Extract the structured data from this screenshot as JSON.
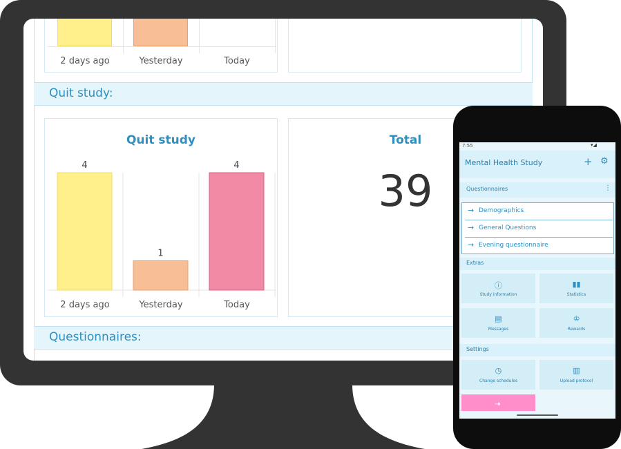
{
  "dashboard": {
    "section_quit_study": "Quit study:",
    "section_questionnaires": "Questionnaires:",
    "top_chart": {
      "categories": [
        "2 days ago",
        "Yesterday",
        "Today"
      ]
    },
    "total_panel": {
      "title": "Total",
      "value": "39"
    }
  },
  "chart_data": [
    {
      "type": "bar",
      "title": "Quit study",
      "categories": [
        "2 days ago",
        "Yesterday",
        "Today"
      ],
      "values": [
        4,
        1,
        4
      ],
      "colors": [
        "#fff08c",
        "#f8bf96",
        "#f28aa6"
      ],
      "ylim": [
        0,
        4
      ],
      "grid": true
    }
  ],
  "phone": {
    "status_time": "7:55",
    "app_title": "Mental Health Study",
    "add_icon": "+",
    "settings_icon": "gear-icon",
    "questionnaires": {
      "header": "Questionnaires",
      "items": [
        "Demographics",
        "General Questions",
        "Evening questionnaire"
      ]
    },
    "extras": {
      "header": "Extras",
      "tiles": [
        {
          "label": "Study information",
          "icon": "info-icon"
        },
        {
          "label": "Statistics",
          "icon": "bar-chart-icon"
        },
        {
          "label": "Messages",
          "icon": "message-icon"
        },
        {
          "label": "Rewards",
          "icon": "trophy-icon"
        }
      ]
    },
    "settings": {
      "header": "Settings",
      "tiles": [
        {
          "label": "Change schedules",
          "icon": "clock-icon"
        },
        {
          "label": "Upload protocol",
          "icon": "book-icon"
        }
      ],
      "logout_icon": "logout-icon",
      "logout_color": "#ff8ecb"
    },
    "accent_color": "#2f8fbf"
  }
}
